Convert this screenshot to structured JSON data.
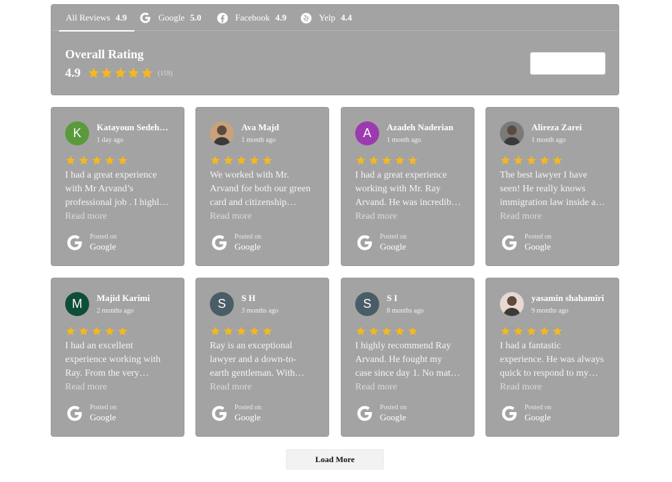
{
  "colors": {
    "panel": "#a3a3a3",
    "star": "#f6b81e",
    "text": "#ffffff"
  },
  "tabs": [
    {
      "label": "All Reviews",
      "score": "4.9",
      "icon": "none"
    },
    {
      "label": "Google",
      "score": "5.0",
      "icon": "google-icon"
    },
    {
      "label": "Facebook",
      "score": "4.9",
      "icon": "facebook-icon"
    },
    {
      "label": "Yelp",
      "score": "4.4",
      "icon": "yelp-icon"
    }
  ],
  "overall": {
    "title": "Overall Rating",
    "score": "4.9",
    "stars": 5,
    "count": "(159)"
  },
  "write_button_label": "",
  "reviews": [
    {
      "name": "Katayoun Sedeh…",
      "date": "1 day ago",
      "initial": "K",
      "avatar_color": "#5a9a3a",
      "stars": 5,
      "text": [
        "I had a great experience",
        "with Mr Arvand’s",
        "professional job . I highl…"
      ],
      "read_more": "Read more",
      "posted_on": "Posted on",
      "source": "Google"
    },
    {
      "name": "Ava Majd",
      "date": "1 month ago",
      "initial": "",
      "avatar_color": "#c9a27a",
      "stars": 5,
      "text": [
        "We worked with Mr.",
        "Arvand for both our green",
        "card and citizenship…"
      ],
      "read_more": "Read more",
      "posted_on": "Posted on",
      "source": "Google"
    },
    {
      "name": "Azadeh Naderian",
      "date": "1 month ago",
      "initial": "A",
      "avatar_color": "#9c3ab0",
      "stars": 5,
      "text": [
        "I had a great experience",
        "working with Mr. Ray",
        "Arvand. He was incredib…"
      ],
      "read_more": "Read more",
      "posted_on": "Posted on",
      "source": "Google"
    },
    {
      "name": "Alireza Zarei",
      "date": "1 month ago",
      "initial": "",
      "avatar_color": "#7a7a7a",
      "stars": 5,
      "text": [
        "The best lawyer I have",
        "seen! He really knows",
        "immigration law inside a…"
      ],
      "read_more": "Read more",
      "posted_on": "Posted on",
      "source": "Google"
    },
    {
      "name": "Majid Karimi",
      "date": "2 months ago",
      "initial": "M",
      "avatar_color": "#0f4d3a",
      "stars": 5,
      "text": [
        "I had an excellent",
        "experience working with",
        "Ray. From the very…"
      ],
      "read_more": "Read more",
      "posted_on": "Posted on",
      "source": "Google"
    },
    {
      "name": "S H",
      "date": "3 months ago",
      "initial": "S",
      "avatar_color": "#4a5d66",
      "stars": 5,
      "text": [
        "Ray is an exceptional",
        "lawyer and a down-to-",
        "earth gentleman. With…"
      ],
      "read_more": "Read more",
      "posted_on": "Posted on",
      "source": "Google"
    },
    {
      "name": "S I",
      "date": "8 months ago",
      "initial": "S",
      "avatar_color": "#4a5d66",
      "stars": 5,
      "text": [
        "I highly recommend Ray",
        "Arvand. He fought my",
        "case since day 1. No mat…"
      ],
      "read_more": "Read more",
      "posted_on": "Posted on",
      "source": "Google"
    },
    {
      "name": "yasamin shahamiri",
      "date": "9 months ago",
      "initial": "",
      "avatar_color": "#e8d9d0",
      "stars": 5,
      "text": [
        "I had a fantastic",
        "experience. He was always",
        "quick to respond to my…"
      ],
      "read_more": "Read more",
      "posted_on": "Posted on",
      "source": "Google"
    }
  ],
  "load_more_label": "Load More"
}
